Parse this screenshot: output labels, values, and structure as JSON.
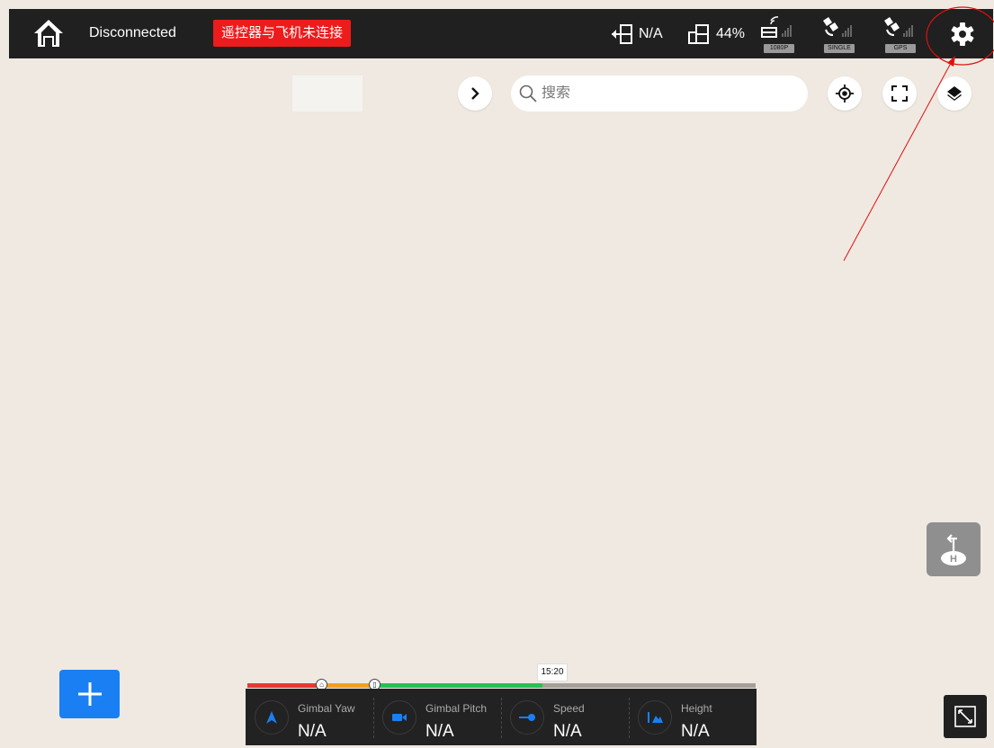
{
  "topbar": {
    "connection_status": "Disconnected",
    "warning": "遥控器与飞机未连接",
    "rc_battery": "N/A",
    "aircraft_battery": "44%",
    "signals": [
      {
        "name": "video-link-signal-icon",
        "tag": "1080P"
      },
      {
        "name": "satellite-signal-icon",
        "tag": "SINGLE"
      },
      {
        "name": "gps-signal-icon",
        "tag": "GPS"
      }
    ]
  },
  "search": {
    "placeholder": "搜索"
  },
  "timeline": {
    "time_label": "15:20",
    "segments": [
      {
        "color": "#e53935",
        "fraction": 0.14
      },
      {
        "color": "#f0a020",
        "fraction": 0.1
      },
      {
        "color": "#27c056",
        "fraction": 0.34
      },
      {
        "color": "#a59f99",
        "fraction": 0.42
      }
    ]
  },
  "telemetry": [
    {
      "icon": "gimbal-yaw-icon",
      "label": "Gimbal Yaw",
      "value": "N/A"
    },
    {
      "icon": "gimbal-pitch-icon",
      "label": "Gimbal Pitch",
      "value": "N/A"
    },
    {
      "icon": "speed-icon",
      "label": "Speed",
      "value": "N/A"
    },
    {
      "icon": "height-icon",
      "label": "Height",
      "value": "N/A"
    }
  ],
  "colors": {
    "accent": "#1a7ff3",
    "warning": "#ec1c1c",
    "annotation": "#e01010",
    "topbar": "#202020"
  }
}
